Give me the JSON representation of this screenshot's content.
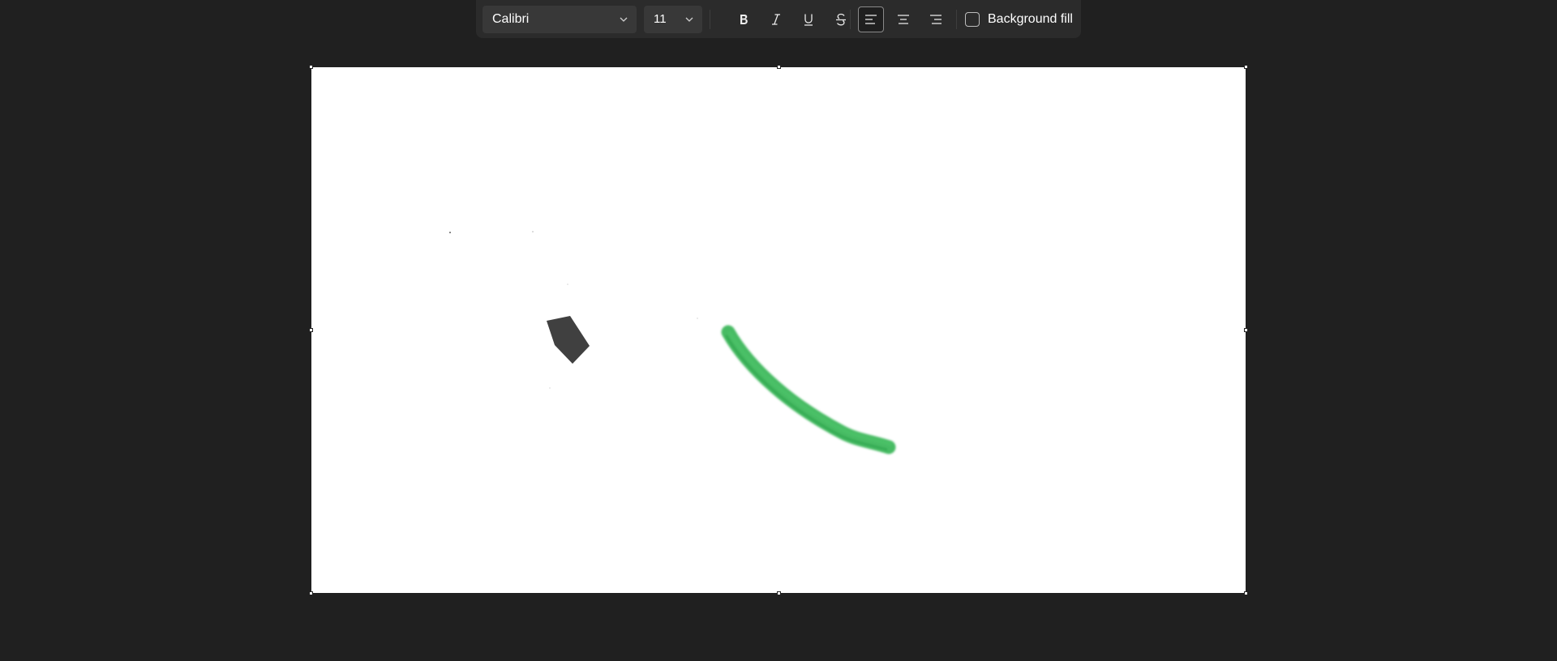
{
  "toolbar": {
    "font_family": "Calibri",
    "font_size": "11",
    "bold_icon": "bold-icon",
    "italic_icon": "italic-icon",
    "underline_icon": "underline-icon",
    "strikethrough_icon": "strikethrough-icon",
    "align_left_icon": "align-left-icon",
    "align_center_icon": "align-center-icon",
    "align_right_icon": "align-right-icon",
    "align_selected": "left",
    "background_fill_label": "Background fill",
    "background_fill_checked": false
  },
  "canvas": {
    "background": "#ffffff",
    "strokes": [
      {
        "name": "green-highlighter-stroke",
        "color": "#2fb24f"
      },
      {
        "name": "dark-gray-shape",
        "color": "#404040"
      }
    ]
  },
  "colors": {
    "app_background": "#202020",
    "toolbar_background": "#2b2b2b",
    "control_background": "#383838",
    "text": "#ffffff"
  }
}
